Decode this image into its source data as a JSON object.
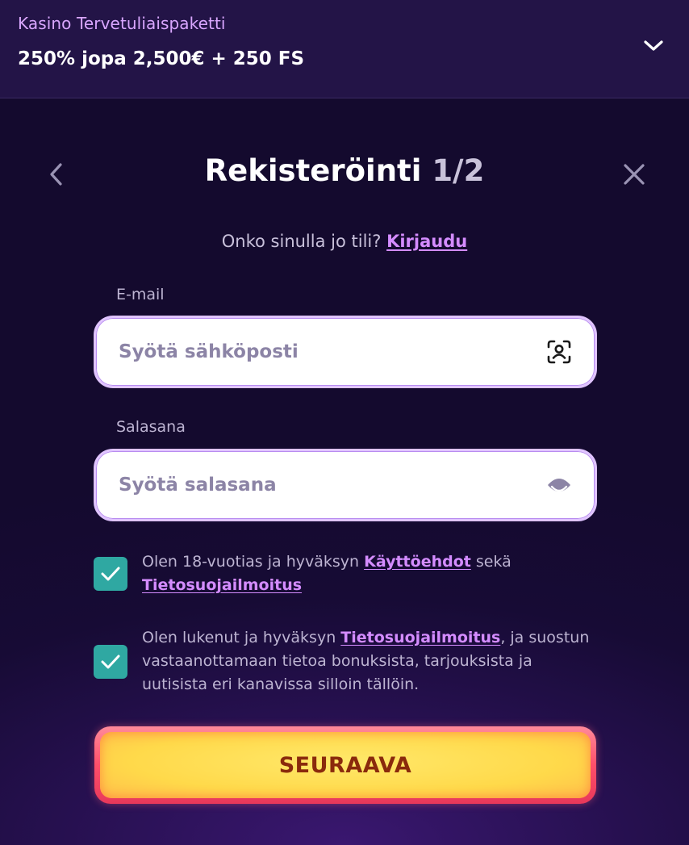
{
  "promo": {
    "subtitle": "Kasino Tervetuliaispaketti",
    "title": "250% jopa 2,500€ + 250 FS"
  },
  "modal": {
    "title": "Rekisteröinti",
    "step": "1/2",
    "login_prompt": "Onko sinulla jo tili?",
    "login_link": "Kirjaudu"
  },
  "email": {
    "label": "E-mail",
    "placeholder": "Syötä sähköposti",
    "value": ""
  },
  "password": {
    "label": "Salasana",
    "placeholder": "Syötä salasana",
    "value": ""
  },
  "consent_terms": {
    "checked": true,
    "text_before": "Olen 18-vuotias ja hyväksyn",
    "link1": "Käyttöehdot",
    "text_middle": "sekä",
    "link2": "Tietosuojailmoitus"
  },
  "consent_marketing": {
    "checked": true,
    "text_before": "Olen lukenut ja hyväksyn",
    "link": "Tietosuojailmoitus",
    "text_after": ", ja suostun vastaanottamaan tietoa bonuksista, tarjouksista ja uutisista eri kanavissa silloin tällöin."
  },
  "submit": {
    "label": "SEURAAVA"
  },
  "icons": {
    "promo_toggle": "chevron-down-icon",
    "back": "chevron-left-icon",
    "close": "close-icon",
    "email_field": "face-id-scan-icon",
    "password_field": "eye-icon",
    "checkbox": "checkmark-icon"
  },
  "colors": {
    "background": "#140a2e",
    "promo_background": "#231447",
    "accent_link": "#d48cff",
    "checkbox": "#2fa8a2",
    "cta_fill": "#ffd94a",
    "cta_border": "#ff4f6a",
    "cta_text": "#8a2a0c"
  }
}
